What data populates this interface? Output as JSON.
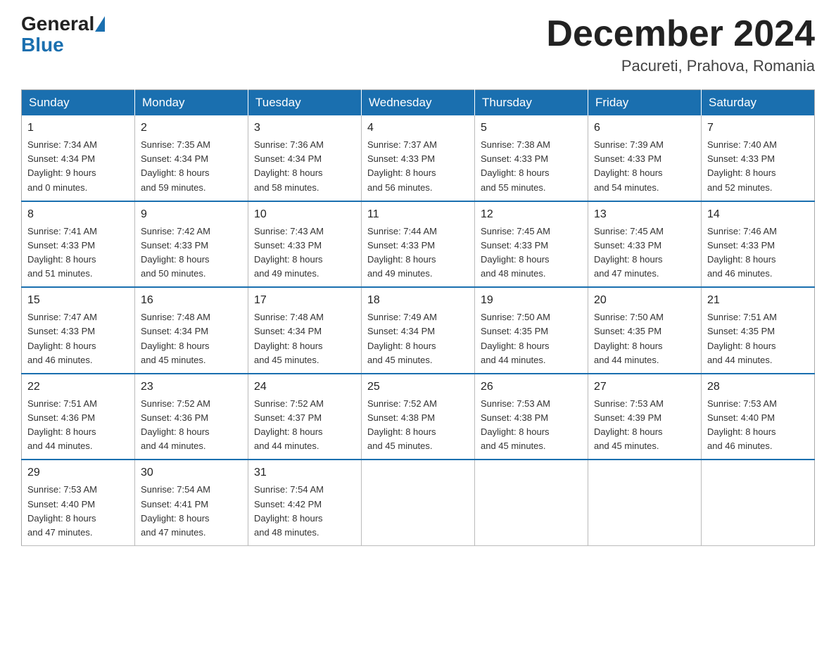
{
  "logo": {
    "general": "General",
    "blue": "Blue"
  },
  "title": "December 2024",
  "subtitle": "Pacureti, Prahova, Romania",
  "weekdays": [
    "Sunday",
    "Monday",
    "Tuesday",
    "Wednesday",
    "Thursday",
    "Friday",
    "Saturday"
  ],
  "weeks": [
    [
      {
        "day": "1",
        "sunrise": "7:34 AM",
        "sunset": "4:34 PM",
        "daylight": "9 hours and 0 minutes."
      },
      {
        "day": "2",
        "sunrise": "7:35 AM",
        "sunset": "4:34 PM",
        "daylight": "8 hours and 59 minutes."
      },
      {
        "day": "3",
        "sunrise": "7:36 AM",
        "sunset": "4:34 PM",
        "daylight": "8 hours and 58 minutes."
      },
      {
        "day": "4",
        "sunrise": "7:37 AM",
        "sunset": "4:33 PM",
        "daylight": "8 hours and 56 minutes."
      },
      {
        "day": "5",
        "sunrise": "7:38 AM",
        "sunset": "4:33 PM",
        "daylight": "8 hours and 55 minutes."
      },
      {
        "day": "6",
        "sunrise": "7:39 AM",
        "sunset": "4:33 PM",
        "daylight": "8 hours and 54 minutes."
      },
      {
        "day": "7",
        "sunrise": "7:40 AM",
        "sunset": "4:33 PM",
        "daylight": "8 hours and 52 minutes."
      }
    ],
    [
      {
        "day": "8",
        "sunrise": "7:41 AM",
        "sunset": "4:33 PM",
        "daylight": "8 hours and 51 minutes."
      },
      {
        "day": "9",
        "sunrise": "7:42 AM",
        "sunset": "4:33 PM",
        "daylight": "8 hours and 50 minutes."
      },
      {
        "day": "10",
        "sunrise": "7:43 AM",
        "sunset": "4:33 PM",
        "daylight": "8 hours and 49 minutes."
      },
      {
        "day": "11",
        "sunrise": "7:44 AM",
        "sunset": "4:33 PM",
        "daylight": "8 hours and 49 minutes."
      },
      {
        "day": "12",
        "sunrise": "7:45 AM",
        "sunset": "4:33 PM",
        "daylight": "8 hours and 48 minutes."
      },
      {
        "day": "13",
        "sunrise": "7:45 AM",
        "sunset": "4:33 PM",
        "daylight": "8 hours and 47 minutes."
      },
      {
        "day": "14",
        "sunrise": "7:46 AM",
        "sunset": "4:33 PM",
        "daylight": "8 hours and 46 minutes."
      }
    ],
    [
      {
        "day": "15",
        "sunrise": "7:47 AM",
        "sunset": "4:33 PM",
        "daylight": "8 hours and 46 minutes."
      },
      {
        "day": "16",
        "sunrise": "7:48 AM",
        "sunset": "4:34 PM",
        "daylight": "8 hours and 45 minutes."
      },
      {
        "day": "17",
        "sunrise": "7:48 AM",
        "sunset": "4:34 PM",
        "daylight": "8 hours and 45 minutes."
      },
      {
        "day": "18",
        "sunrise": "7:49 AM",
        "sunset": "4:34 PM",
        "daylight": "8 hours and 45 minutes."
      },
      {
        "day": "19",
        "sunrise": "7:50 AM",
        "sunset": "4:35 PM",
        "daylight": "8 hours and 44 minutes."
      },
      {
        "day": "20",
        "sunrise": "7:50 AM",
        "sunset": "4:35 PM",
        "daylight": "8 hours and 44 minutes."
      },
      {
        "day": "21",
        "sunrise": "7:51 AM",
        "sunset": "4:35 PM",
        "daylight": "8 hours and 44 minutes."
      }
    ],
    [
      {
        "day": "22",
        "sunrise": "7:51 AM",
        "sunset": "4:36 PM",
        "daylight": "8 hours and 44 minutes."
      },
      {
        "day": "23",
        "sunrise": "7:52 AM",
        "sunset": "4:36 PM",
        "daylight": "8 hours and 44 minutes."
      },
      {
        "day": "24",
        "sunrise": "7:52 AM",
        "sunset": "4:37 PM",
        "daylight": "8 hours and 44 minutes."
      },
      {
        "day": "25",
        "sunrise": "7:52 AM",
        "sunset": "4:38 PM",
        "daylight": "8 hours and 45 minutes."
      },
      {
        "day": "26",
        "sunrise": "7:53 AM",
        "sunset": "4:38 PM",
        "daylight": "8 hours and 45 minutes."
      },
      {
        "day": "27",
        "sunrise": "7:53 AM",
        "sunset": "4:39 PM",
        "daylight": "8 hours and 45 minutes."
      },
      {
        "day": "28",
        "sunrise": "7:53 AM",
        "sunset": "4:40 PM",
        "daylight": "8 hours and 46 minutes."
      }
    ],
    [
      {
        "day": "29",
        "sunrise": "7:53 AM",
        "sunset": "4:40 PM",
        "daylight": "8 hours and 47 minutes."
      },
      {
        "day": "30",
        "sunrise": "7:54 AM",
        "sunset": "4:41 PM",
        "daylight": "8 hours and 47 minutes."
      },
      {
        "day": "31",
        "sunrise": "7:54 AM",
        "sunset": "4:42 PM",
        "daylight": "8 hours and 48 minutes."
      },
      null,
      null,
      null,
      null
    ]
  ],
  "labels": {
    "sunrise": "Sunrise:",
    "sunset": "Sunset:",
    "daylight": "Daylight:"
  }
}
